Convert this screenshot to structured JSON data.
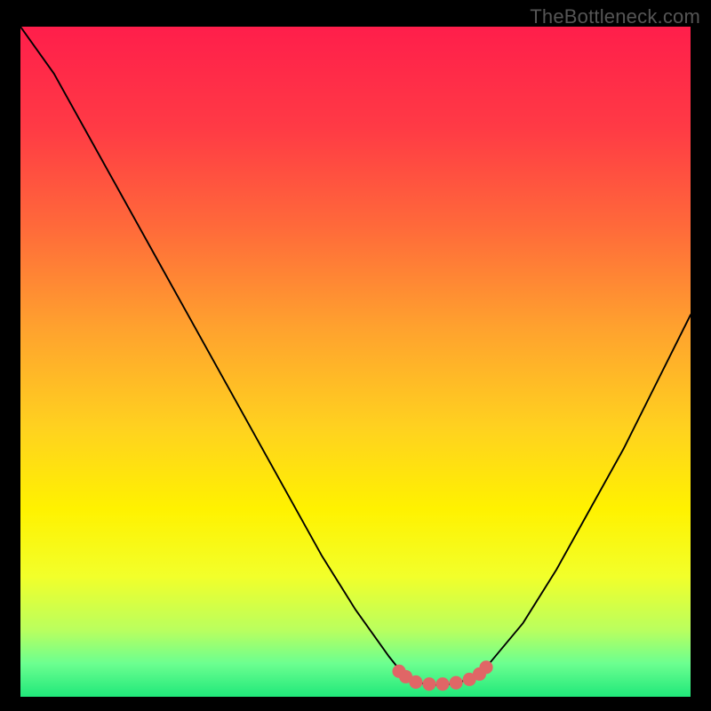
{
  "watermark": "TheBottleneck.com",
  "chart_data": {
    "type": "line",
    "title": "",
    "xlabel": "",
    "ylabel": "",
    "xlim": [
      0,
      100
    ],
    "ylim": [
      0,
      100
    ],
    "series": [
      {
        "name": "bottleneck-curve",
        "x": [
          0,
          5,
          10,
          15,
          20,
          25,
          30,
          35,
          40,
          45,
          50,
          55,
          57,
          59,
          61,
          63,
          65,
          68,
          70,
          75,
          80,
          85,
          90,
          95,
          100
        ],
        "y": [
          100,
          93,
          84,
          75,
          66,
          57,
          48,
          39,
          30,
          21,
          13,
          6,
          3.5,
          2.2,
          1.8,
          1.8,
          2.0,
          3.0,
          5,
          11,
          19,
          28,
          37,
          47,
          57
        ]
      },
      {
        "name": "highlight-dots",
        "x": [
          56.5,
          57.5,
          59,
          61,
          63,
          65,
          67,
          68.5,
          69.5
        ],
        "y": [
          3.8,
          3.0,
          2.2,
          1.9,
          1.9,
          2.1,
          2.6,
          3.4,
          4.4
        ]
      }
    ],
    "gradient_stops": [
      {
        "offset": 0.0,
        "color": "#ff1e4b"
      },
      {
        "offset": 0.15,
        "color": "#ff3a45"
      },
      {
        "offset": 0.3,
        "color": "#ff6a3a"
      },
      {
        "offset": 0.45,
        "color": "#ffa22e"
      },
      {
        "offset": 0.6,
        "color": "#ffd21f"
      },
      {
        "offset": 0.72,
        "color": "#fff200"
      },
      {
        "offset": 0.82,
        "color": "#f2ff2a"
      },
      {
        "offset": 0.9,
        "color": "#baff5e"
      },
      {
        "offset": 0.95,
        "color": "#6cff90"
      },
      {
        "offset": 1.0,
        "color": "#20e87a"
      }
    ],
    "dot_color": "#e06666",
    "curve_color": "#000000"
  }
}
